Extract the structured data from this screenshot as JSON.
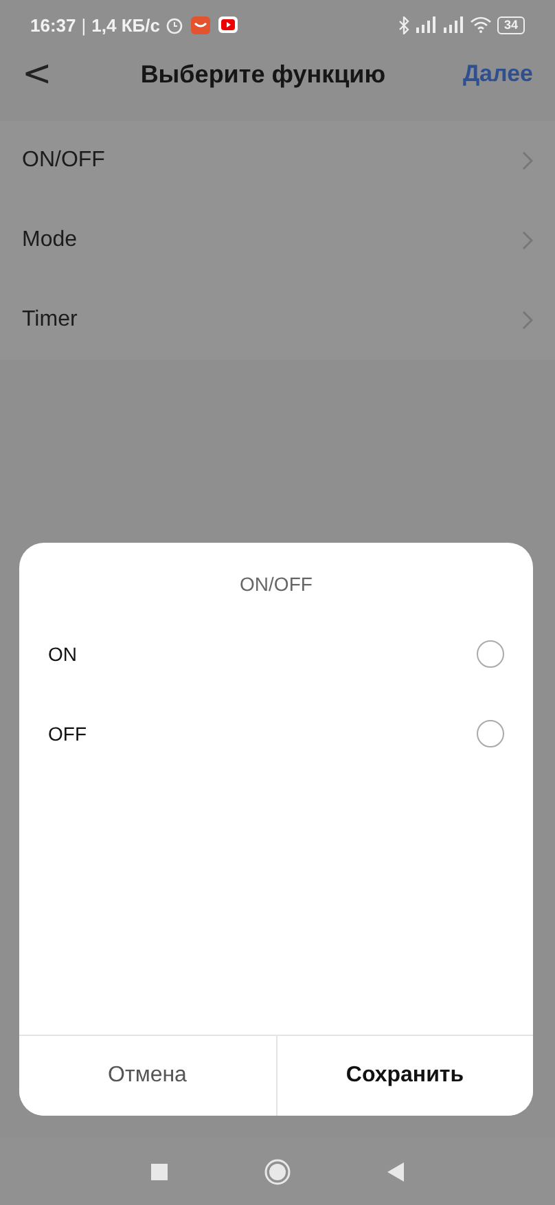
{
  "status_bar": {
    "time": "16:37",
    "separator": "|",
    "speed": "1,4 КБ/с",
    "battery": "34"
  },
  "header": {
    "back": "<",
    "title": "Выберите функцию",
    "action": "Далее"
  },
  "functions": [
    {
      "label": "ON/OFF"
    },
    {
      "label": "Mode"
    },
    {
      "label": "Timer"
    }
  ],
  "dialog": {
    "title": "ON/OFF",
    "options": [
      {
        "label": "ON",
        "selected": false
      },
      {
        "label": "OFF",
        "selected": false
      }
    ],
    "buttons": [
      {
        "label": "Отмена",
        "kind": "cancel"
      },
      {
        "label": "Сохранить",
        "kind": "primary"
      }
    ]
  }
}
